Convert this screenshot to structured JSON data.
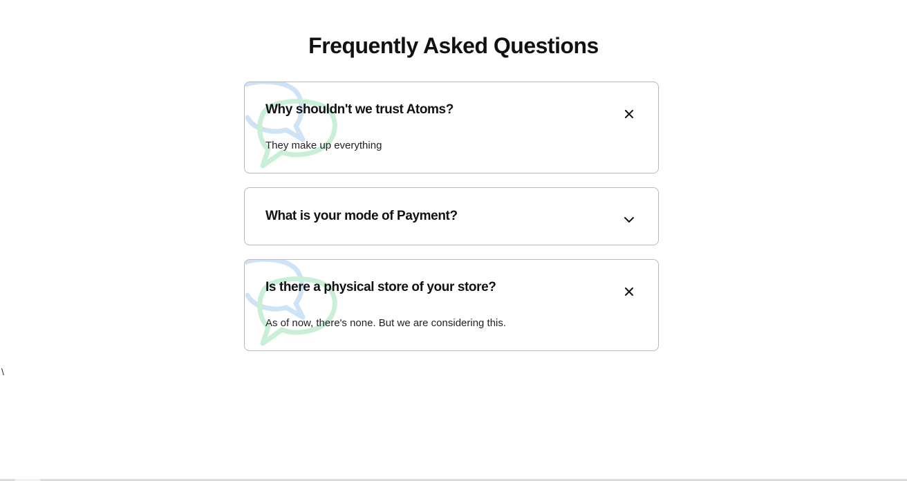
{
  "page": {
    "title": "Frequently Asked Questions"
  },
  "faq": {
    "items": [
      {
        "question": "Why shouldn't we trust Atoms?",
        "answer": "They make up everything",
        "expanded": true,
        "toggle_icon": "close-icon"
      },
      {
        "question": "What is your mode of Payment?",
        "answer": "",
        "expanded": false,
        "toggle_icon": "chevron-down-icon"
      },
      {
        "question": "Is there a physical store of your store?",
        "answer": "As of now, there's none. But we are considering this.",
        "expanded": true,
        "toggle_icon": "close-icon"
      }
    ]
  },
  "stray_text": "\\",
  "colors": {
    "bubble_blue": "#cfe3f7",
    "bubble_green": "#c9f0d6",
    "card_border": "#b8b8b8",
    "text": "#111111"
  }
}
